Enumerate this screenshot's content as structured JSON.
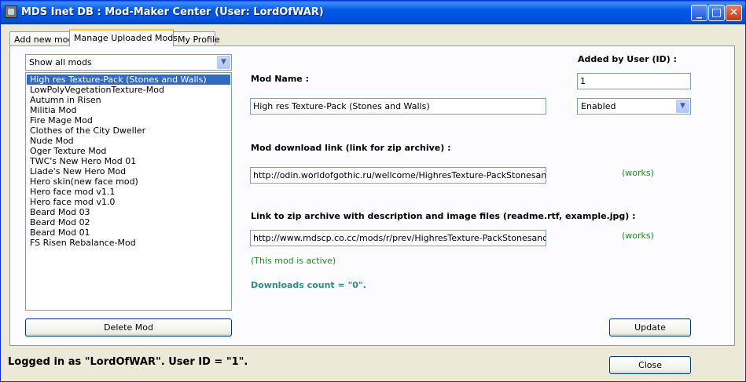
{
  "window": {
    "title": "MDS Inet DB : Mod-Maker Center (User: LordOfWAR)",
    "minimize_glyph": "_",
    "maximize_glyph": "□",
    "close_glyph": "✕"
  },
  "tabs": [
    {
      "label": "Add new mod"
    },
    {
      "label": "Manage Uploaded Mods",
      "active": true
    },
    {
      "label": "My Profile"
    }
  ],
  "filter": {
    "selected": "Show all mods"
  },
  "mods_list": [
    "High res Texture-Pack (Stones and Walls)",
    "LowPolyVegetationTexture-Mod",
    "Autumn in Risen",
    "Militia Mod",
    "Fire Mage Mod",
    "Clothes of the City Dweller",
    "Nude Mod",
    "Oger Texture Mod",
    "TWC's New Hero Mod 01",
    "Liade's New Hero Mod",
    "Hero skin(new face mod)",
    "Hero face mod v1.1",
    "Hero face mod v1.0",
    "Beard Mod 03",
    "Beard Mod 02",
    "Beard Mod 01",
    "FS Risen Rebalance-Mod"
  ],
  "selected_index": 0,
  "delete_button": "Delete Mod",
  "details": {
    "mod_name_label": "Mod Name :",
    "mod_name_value": "High res Texture-Pack (Stones and Walls)",
    "added_by_label": "Added by User (ID) :",
    "added_by_value": "1",
    "status_selected": "Enabled",
    "download_link_label": "Mod download link (link for zip archive) :",
    "download_link_value": "http://odin.worldofgothic.ru/wellcome/HighresTexture-PackStonesandWallsV",
    "download_link_status": "(works)",
    "archive_link_label": "Link to zip archive with description and image files (readme.rtf, example.jpg) :",
    "archive_link_value": "http://www.mdscp.co.cc/mods/r/prev/HighresTexture-PackStonesandWalls",
    "archive_link_status": "(works)",
    "active_note": "(This mod is active)",
    "downloads_count": "Downloads count = \"0\".",
    "update_button": "Update"
  },
  "status_bar": "Logged in as \"LordOfWAR\". User ID = \"1\".",
  "close_button": "Close",
  "colors": {
    "titlebar": "#0054e3",
    "selection": "#316ac5",
    "works_text": "#228b22",
    "downloads_text": "#2e8b8b"
  }
}
